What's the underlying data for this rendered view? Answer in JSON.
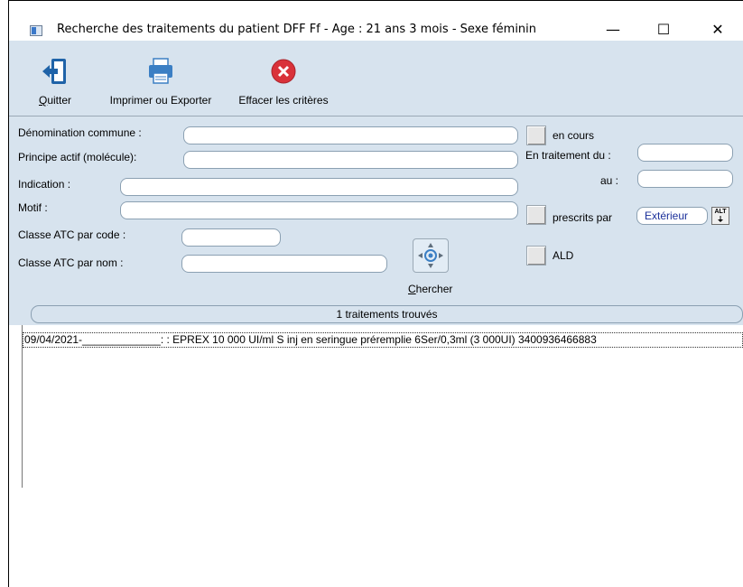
{
  "window": {
    "title": "Recherche des traitements du patient DFF Ff - Age : 21 ans 3 mois - Sexe féminin",
    "minimize_symbol": "—",
    "maximize_symbol": "☐",
    "close_symbol": "✕"
  },
  "toolbar": {
    "quit_hotkey": "Q",
    "quit_rest": "uitter",
    "print_label": "Imprimer ou Exporter",
    "clear_label": "Effacer les critères"
  },
  "form": {
    "denomination_label": "Dénomination commune :",
    "denomination_value": "",
    "principe_label": "Principe actif (molécule):",
    "principe_value": "",
    "indication_label": "Indication :",
    "indication_value": "",
    "motif_label": "Motif :",
    "motif_value": "",
    "atc_code_label": "Classe ATC par code :",
    "atc_code_value": "",
    "atc_nom_label": "Classe ATC par nom :",
    "atc_nom_value": "",
    "en_cours_label": "en cours",
    "en_traitement_label": "En traitement du :",
    "date_from_value": "",
    "au_label": "au :",
    "date_to_value": "",
    "prescrits_label": "prescrits par",
    "prescriber_value": "Extérieur",
    "alt_label": "ALT",
    "ald_label": "ALD",
    "search_hotkey": "C",
    "search_rest": "hercher"
  },
  "results": {
    "count_label": "1 traitements trouvés",
    "rows": [
      "09/04/2021-_____________: : EPREX 10 000 UI/ml S inj en seringue préremplie 6Ser/0,3ml (3 000UI) 3400936466883"
    ]
  },
  "colors": {
    "panel": "#d7e3ee",
    "quit_icon": "#1f63a8",
    "print_icon": "#3b7fc4",
    "clear_icon": "#d9323a"
  }
}
